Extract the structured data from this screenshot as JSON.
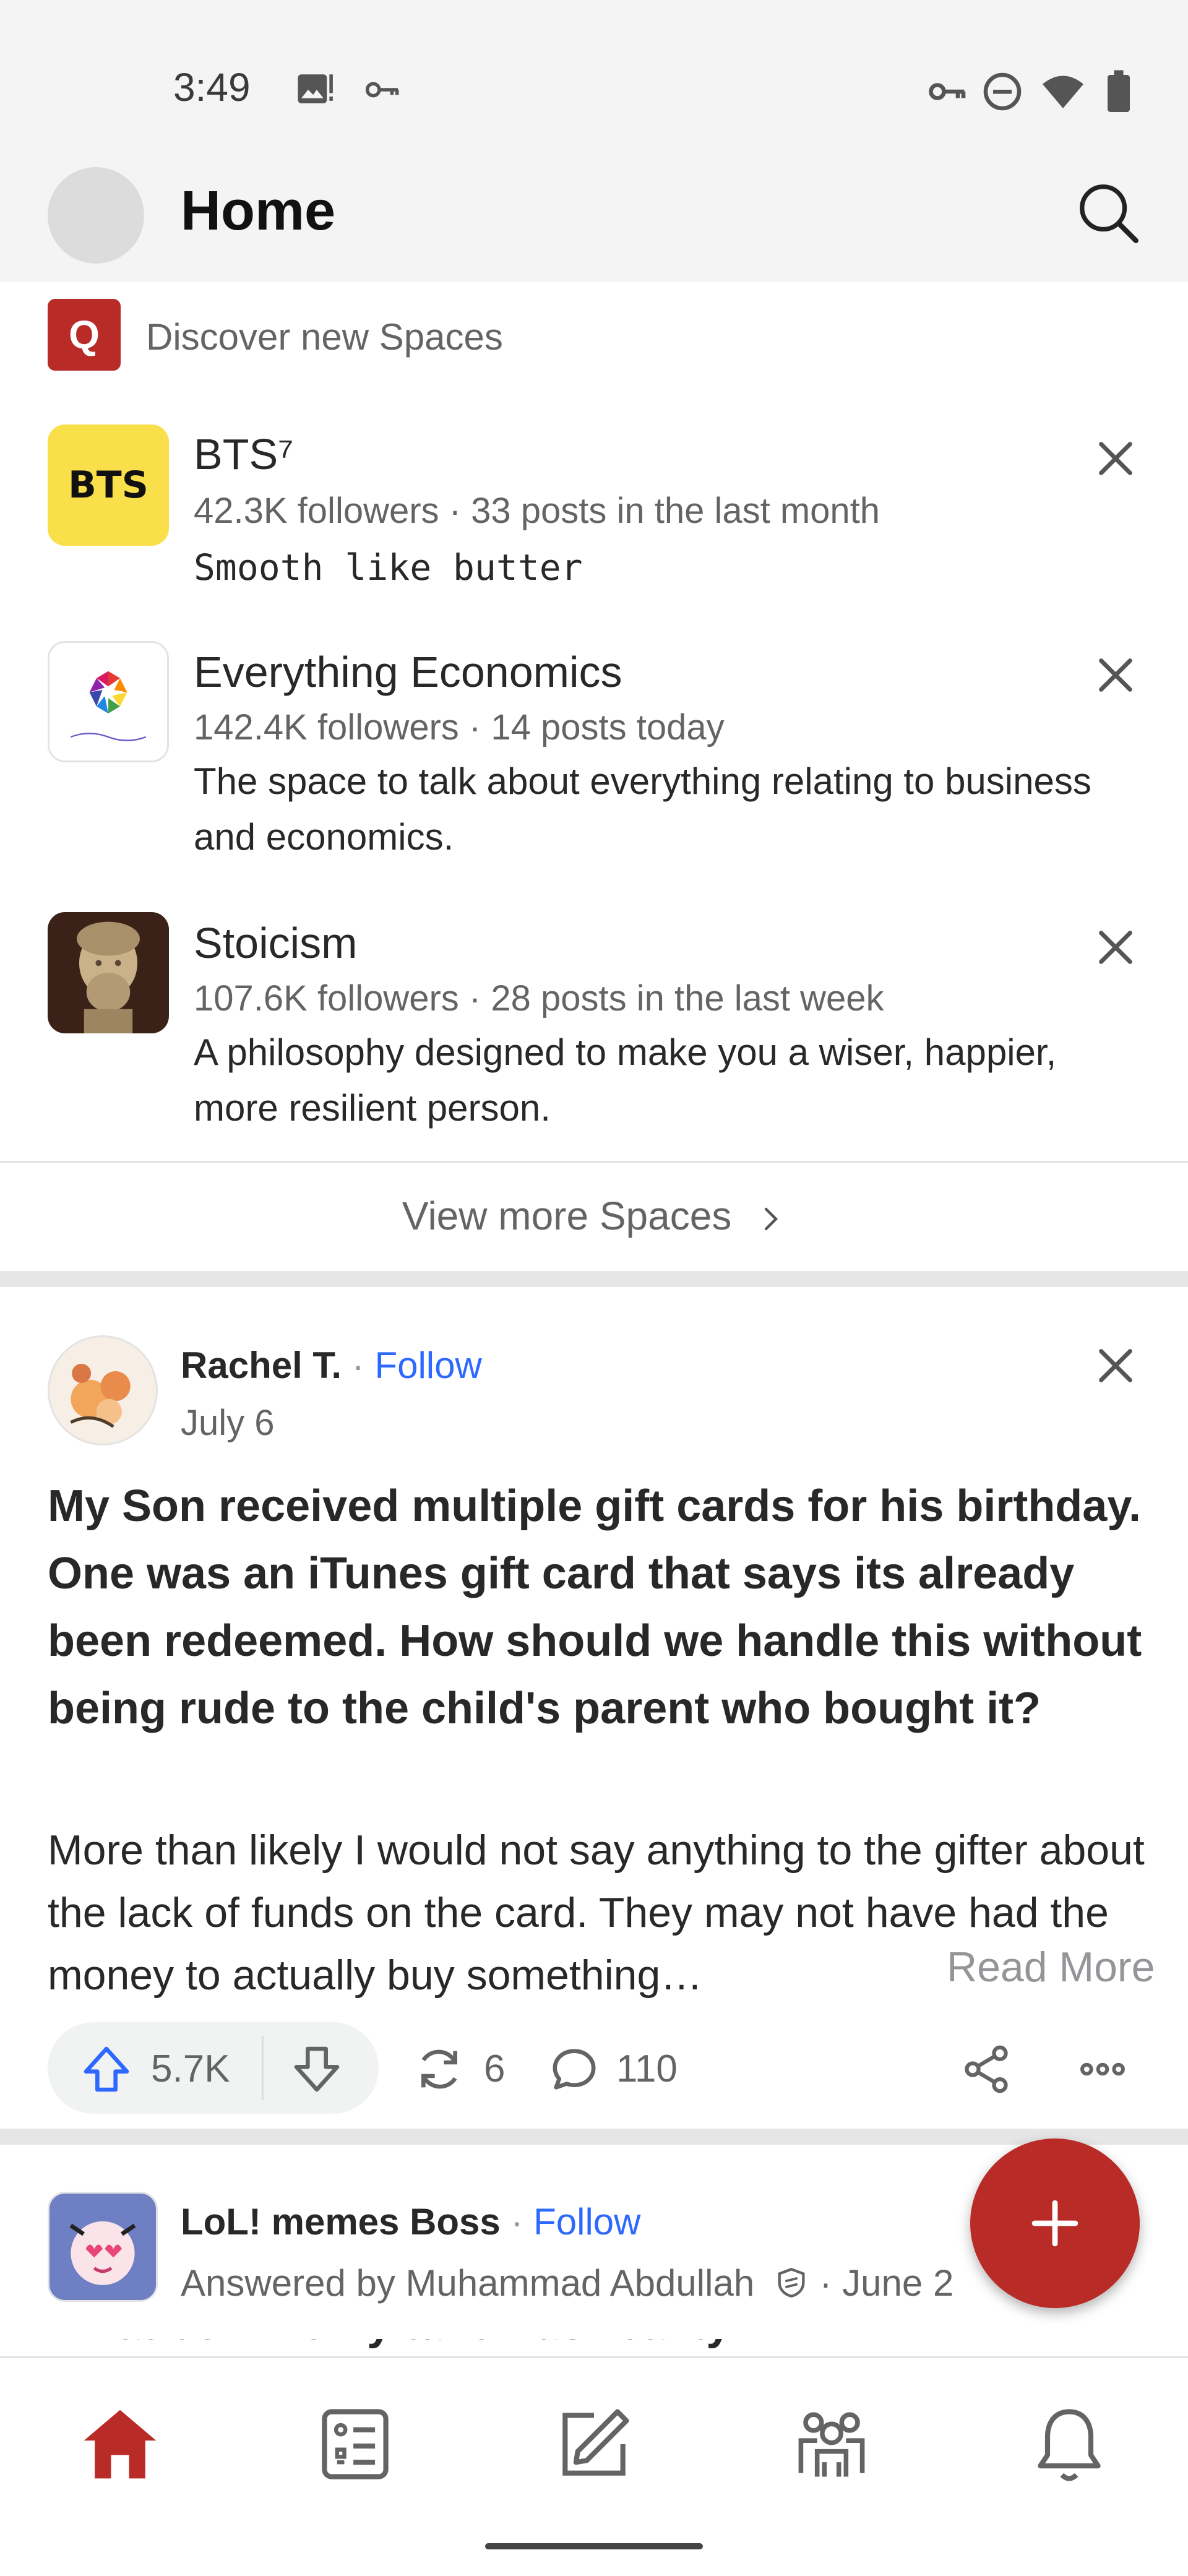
{
  "status_bar": {
    "time": "3:49"
  },
  "header": {
    "title": "Home"
  },
  "discover": {
    "logo_letter": "Q",
    "label": "Discover new Spaces"
  },
  "spaces": [
    {
      "name": "BTS⁷",
      "logo_text": "BTS",
      "meta": "42.3K followers · 33 posts in the last month",
      "description": "Smooth like butter"
    },
    {
      "name": "Everything Economics",
      "meta": "142.4K followers · 14 posts today",
      "description": "The space to talk about everything relating to business and economics."
    },
    {
      "name": "Stoicism",
      "meta": "107.6K followers · 28 posts in the last week",
      "description": "A philosophy designed to make you a wiser, happier, more resilient person."
    }
  ],
  "view_more": {
    "label": "View more Spaces"
  },
  "post": {
    "author": "Rachel T.",
    "separator": " · ",
    "follow_label": "Follow",
    "date": "July 6",
    "title": "My Son received multiple gift cards for his birthday. One was an iTunes gift card that says its already been redeemed. How should we handle this without being rude to the child's parent who bought it?",
    "excerpt": "More than likely I would not say anything to the gifter about the lack of funds on the card. They may not have had the money to actually buy something…",
    "read_more": "Read More",
    "upvotes": "5.7K",
    "shares": "6",
    "comments": "110"
  },
  "next_post": {
    "author": "LoL! memes Boss",
    "separator": " · ",
    "follow_label": "Follow",
    "answered_by": "Answered by Muhammad Abdullah",
    "date_partial": " · June 2",
    "title_partial": "What commonly taken-as-reality..."
  },
  "icons": {
    "header": [
      "search-icon"
    ],
    "space_row": [
      "close-icon"
    ],
    "actions": [
      "upvote-icon",
      "downvote-icon",
      "share-reload-icon",
      "comment-icon",
      "share-icon",
      "more-icon"
    ],
    "nav": [
      "home-icon",
      "following-icon",
      "write-icon",
      "spaces-icon",
      "notifications-icon"
    ],
    "fab": [
      "plus-icon"
    ]
  },
  "colors": {
    "brand": "#b92b27",
    "link": "#2e69ff",
    "text": "#282829",
    "muted": "#636466",
    "chrome": "#f4f4f4"
  }
}
